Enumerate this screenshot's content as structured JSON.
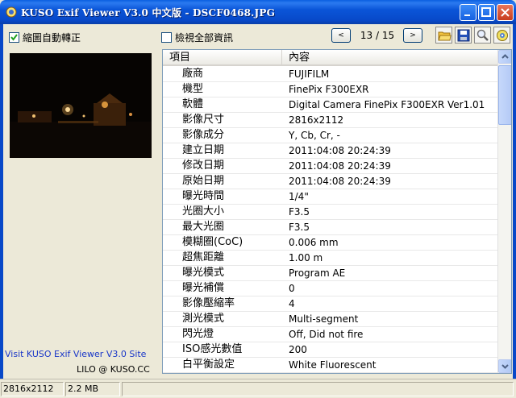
{
  "window": {
    "title": "KUSO Exif Viewer V3.0 中文版 - DSCF0468.JPG"
  },
  "toolbar": {
    "shrink_rotate_label": "縮圖自動轉正",
    "shrink_rotate_checked": true,
    "show_all_label": "檢視全部資訊",
    "show_all_checked": false,
    "prev_label": "<",
    "next_label": ">",
    "pager_text": "13 / 15",
    "icons": [
      "open-folder-icon",
      "save-icon",
      "zoom-icon",
      "settings-icon"
    ]
  },
  "left": {
    "visit_link": "Visit KUSO Exif Viewer V3.0 Site",
    "credit": "LILO @ KUSO.CC"
  },
  "table": {
    "col_item": "項目",
    "col_value": "內容",
    "rows": [
      {
        "item": "廠商",
        "value": "FUJIFILM"
      },
      {
        "item": "機型",
        "value": "FinePix F300EXR"
      },
      {
        "item": "軟體",
        "value": "Digital Camera FinePix F300EXR Ver1.01"
      },
      {
        "item": "影像尺寸",
        "value": "2816x2112"
      },
      {
        "item": "影像成分",
        "value": "Y, Cb, Cr, -"
      },
      {
        "item": "建立日期",
        "value": "2011:04:08 20:24:39"
      },
      {
        "item": "修改日期",
        "value": "2011:04:08 20:24:39"
      },
      {
        "item": "原始日期",
        "value": "2011:04:08 20:24:39"
      },
      {
        "item": "曝光時間",
        "value": "1/4\""
      },
      {
        "item": "光圈大小",
        "value": "F3.5"
      },
      {
        "item": "最大光圈",
        "value": "F3.5"
      },
      {
        "item": "模糊圈(CoC)",
        "value": "0.006 mm"
      },
      {
        "item": "超焦距離",
        "value": "1.00 m"
      },
      {
        "item": "曝光模式",
        "value": "Program AE"
      },
      {
        "item": "曝光補償",
        "value": "0"
      },
      {
        "item": "影像壓縮率",
        "value": "4"
      },
      {
        "item": "測光模式",
        "value": "Multi-segment"
      },
      {
        "item": "閃光燈",
        "value": "Off, Did not fire"
      },
      {
        "item": "ISO感光數值",
        "value": "200"
      },
      {
        "item": "白平衡設定",
        "value": "White Fluorescent"
      },
      {
        "item": "",
        "value": ""
      }
    ]
  },
  "status": {
    "dimensions": "2816x2112",
    "filesize": "2.2 MB"
  },
  "colors": {
    "titlebar": "#0a55d8",
    "link": "#1a37c8"
  }
}
